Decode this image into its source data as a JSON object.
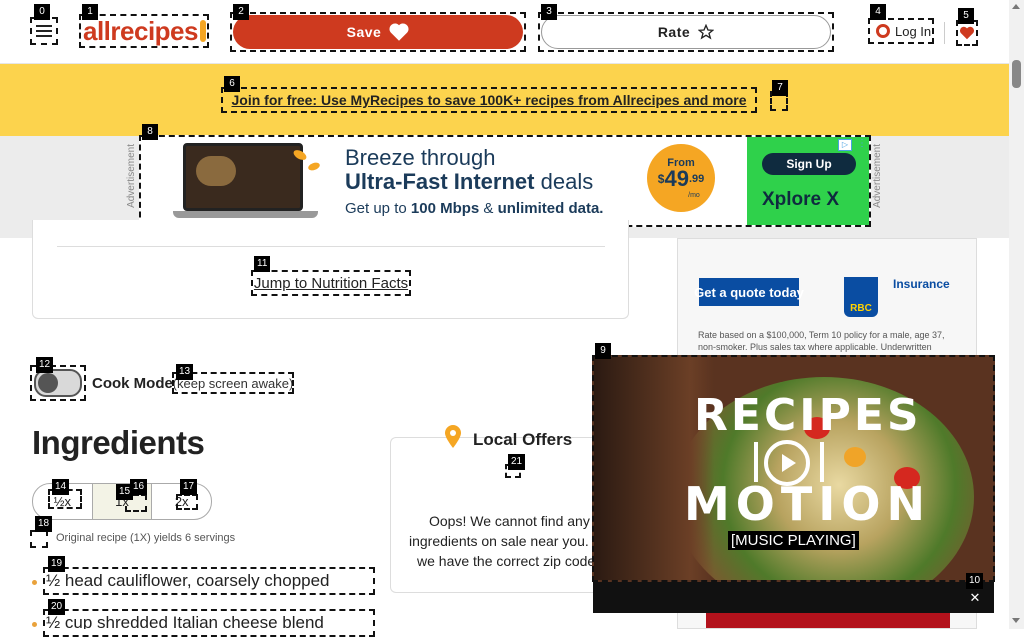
{
  "header": {
    "logo_text": "allrecipes",
    "save_label": "Save",
    "rate_label": "Rate",
    "login_label": "Log In"
  },
  "banner": {
    "link_text": "Join for free: Use MyRecipes to save 100K+ recipes from Allrecipes and more"
  },
  "top_ad": {
    "side_label": "Advertisement",
    "headline_line1": "Breeze through",
    "headline_bold": "Ultra-Fast Internet",
    "headline_tail": "deals",
    "sub_prefix": "Get up to",
    "sub_bold1": "100 Mbps",
    "sub_amp": "&",
    "sub_bold2": "unlimited data.",
    "price_from": "From",
    "price_dollar": "$",
    "price_main": "49",
    "price_cents": ".99",
    "price_per": "/mo",
    "signup_label": "Sign Up",
    "brand": "Xplore X",
    "colors": {
      "accent_orange": "#f5a623",
      "brand_green": "#2fd14b"
    }
  },
  "nutrition": {
    "jump_label": "Jump to Nutrition Facts"
  },
  "cook_mode": {
    "label": "Cook Mode",
    "note": "(keep screen awake)"
  },
  "ingredients": {
    "heading": "Ingredients",
    "scale_options": [
      "½x",
      "1x",
      "2x"
    ],
    "yield_note": "Original recipe (1X) yields 6 servings",
    "items": [
      "½ head cauliflower, coarsely chopped",
      "½ cup shredded Italian cheese blend"
    ]
  },
  "local_offers": {
    "heading": "Local Offers",
    "message_line1": "Oops! We cannot find any",
    "message_line2": "ingredients on sale near you.",
    "message_line3": "we have the correct zip code"
  },
  "side_ad": {
    "cta": "Get a quote today",
    "brand": "RBC",
    "category": "Insurance",
    "fine_print_1": "Rate based on a $100,000, Term 10 policy for a male, age 37,",
    "fine_print_2": "non-smoker. Plus sales tax where applicable. Underwritten"
  },
  "video": {
    "title_line1": "RECIPES",
    "title_line2": "MOTION",
    "caption": "[MUSIC PLAYING]"
  },
  "markers": [
    "0",
    "1",
    "2",
    "3",
    "4",
    "5",
    "6",
    "7",
    "8",
    "9",
    "10",
    "11",
    "12",
    "13",
    "14",
    "15",
    "16",
    "17",
    "18",
    "19",
    "20",
    "21"
  ]
}
